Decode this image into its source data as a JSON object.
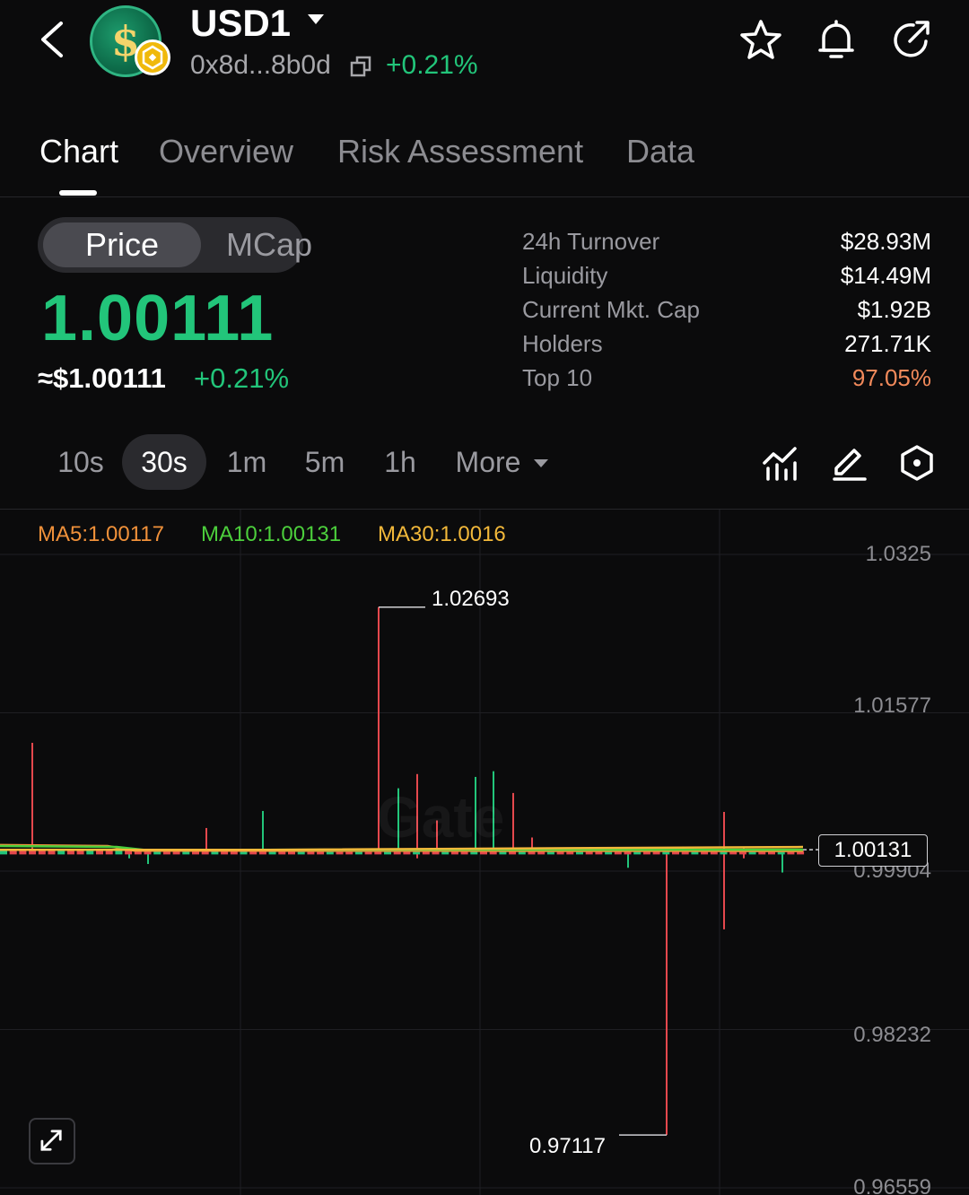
{
  "header": {
    "token_name": "USD1",
    "address": "0x8d...8b0d",
    "change": "+0.21%",
    "icons": [
      "back-icon",
      "star-icon",
      "bell-icon",
      "share-icon",
      "copy-icon"
    ]
  },
  "tabs": [
    "Chart",
    "Overview",
    "Risk Assessment",
    "Data"
  ],
  "price_toggle": {
    "selected": "Price",
    "other": "MCap"
  },
  "price": {
    "value": "1.00111",
    "usd": "≈$1.00111",
    "change": "+0.21%"
  },
  "stats": [
    {
      "label": "24h  Turnover",
      "value": "$28.93M"
    },
    {
      "label": "Liquidity",
      "value": "$14.49M"
    },
    {
      "label": "Current Mkt. Cap",
      "value": "$1.92B"
    },
    {
      "label": "Holders",
      "value": "271.71K"
    },
    {
      "label": "Top 10",
      "value": "97.05%"
    }
  ],
  "intervals": {
    "options": [
      "10s",
      "30s",
      "1m",
      "5m",
      "1h"
    ],
    "selected": "30s",
    "more_label": "More"
  },
  "colors": {
    "up": "#22c57a",
    "down": "#e5484d",
    "ma5": "#f0913a",
    "ma10": "#4ccf3c",
    "ma30": "#f2b83a",
    "top10": "#f28a5b"
  },
  "chart": {
    "watermark": "Gate",
    "ma5": "MA5:1.00117",
    "ma10": "MA10:1.00131",
    "ma30": "MA30:1.0016",
    "current_price_label": "1.00131",
    "high_label": "1.02693",
    "low_label": "0.97117"
  },
  "chart_data": {
    "type": "candlestick",
    "y_ticks": [
      "1.0325",
      "1.01577",
      "0.99904",
      "0.98232",
      "0.96559"
    ],
    "ylim": [
      0.96559,
      1.0325
    ],
    "high": 1.02693,
    "low": 0.97117,
    "last": 1.00131,
    "ma": [
      {
        "name": "MA5",
        "value": 1.00117
      },
      {
        "name": "MA10",
        "value": 1.00131
      },
      {
        "name": "MA30",
        "value": 1.0016
      }
    ],
    "wicks": [
      {
        "x": 36,
        "high": 1.0126,
        "low": 1.0012,
        "dir": "down"
      },
      {
        "x": 144,
        "high": 1.0012,
        "low": 1.0004,
        "dir": "up"
      },
      {
        "x": 165,
        "high": 1.0011,
        "low": 0.9998,
        "dir": "up"
      },
      {
        "x": 230,
        "high": 1.0036,
        "low": 1.0013,
        "dir": "down"
      },
      {
        "x": 293,
        "high": 1.0054,
        "low": 1.0013,
        "dir": "up"
      },
      {
        "x": 422,
        "high": 1.02693,
        "low": 1.0013,
        "dir": "down"
      },
      {
        "x": 444,
        "high": 1.0078,
        "low": 1.0013,
        "dir": "up"
      },
      {
        "x": 465,
        "high": 1.0093,
        "low": 1.0004,
        "dir": "down"
      },
      {
        "x": 487,
        "high": 1.0044,
        "low": 1.0013,
        "dir": "down"
      },
      {
        "x": 530,
        "high": 1.009,
        "low": 1.0012,
        "dir": "up"
      },
      {
        "x": 550,
        "high": 1.0096,
        "low": 1.0012,
        "dir": "up"
      },
      {
        "x": 572,
        "high": 1.0073,
        "low": 1.0012,
        "dir": "down"
      },
      {
        "x": 593,
        "high": 1.0026,
        "low": 1.0012,
        "dir": "down"
      },
      {
        "x": 700,
        "high": 1.001,
        "low": 0.9994,
        "dir": "up"
      },
      {
        "x": 743,
        "high": 1.001,
        "low": 0.97117,
        "dir": "down"
      },
      {
        "x": 807,
        "high": 1.0053,
        "low": 0.9929,
        "dir": "down"
      },
      {
        "x": 829,
        "high": 1.0016,
        "low": 1.0004,
        "dir": "down"
      },
      {
        "x": 872,
        "high": 1.0009,
        "low": 0.9989,
        "dir": "up"
      }
    ]
  }
}
